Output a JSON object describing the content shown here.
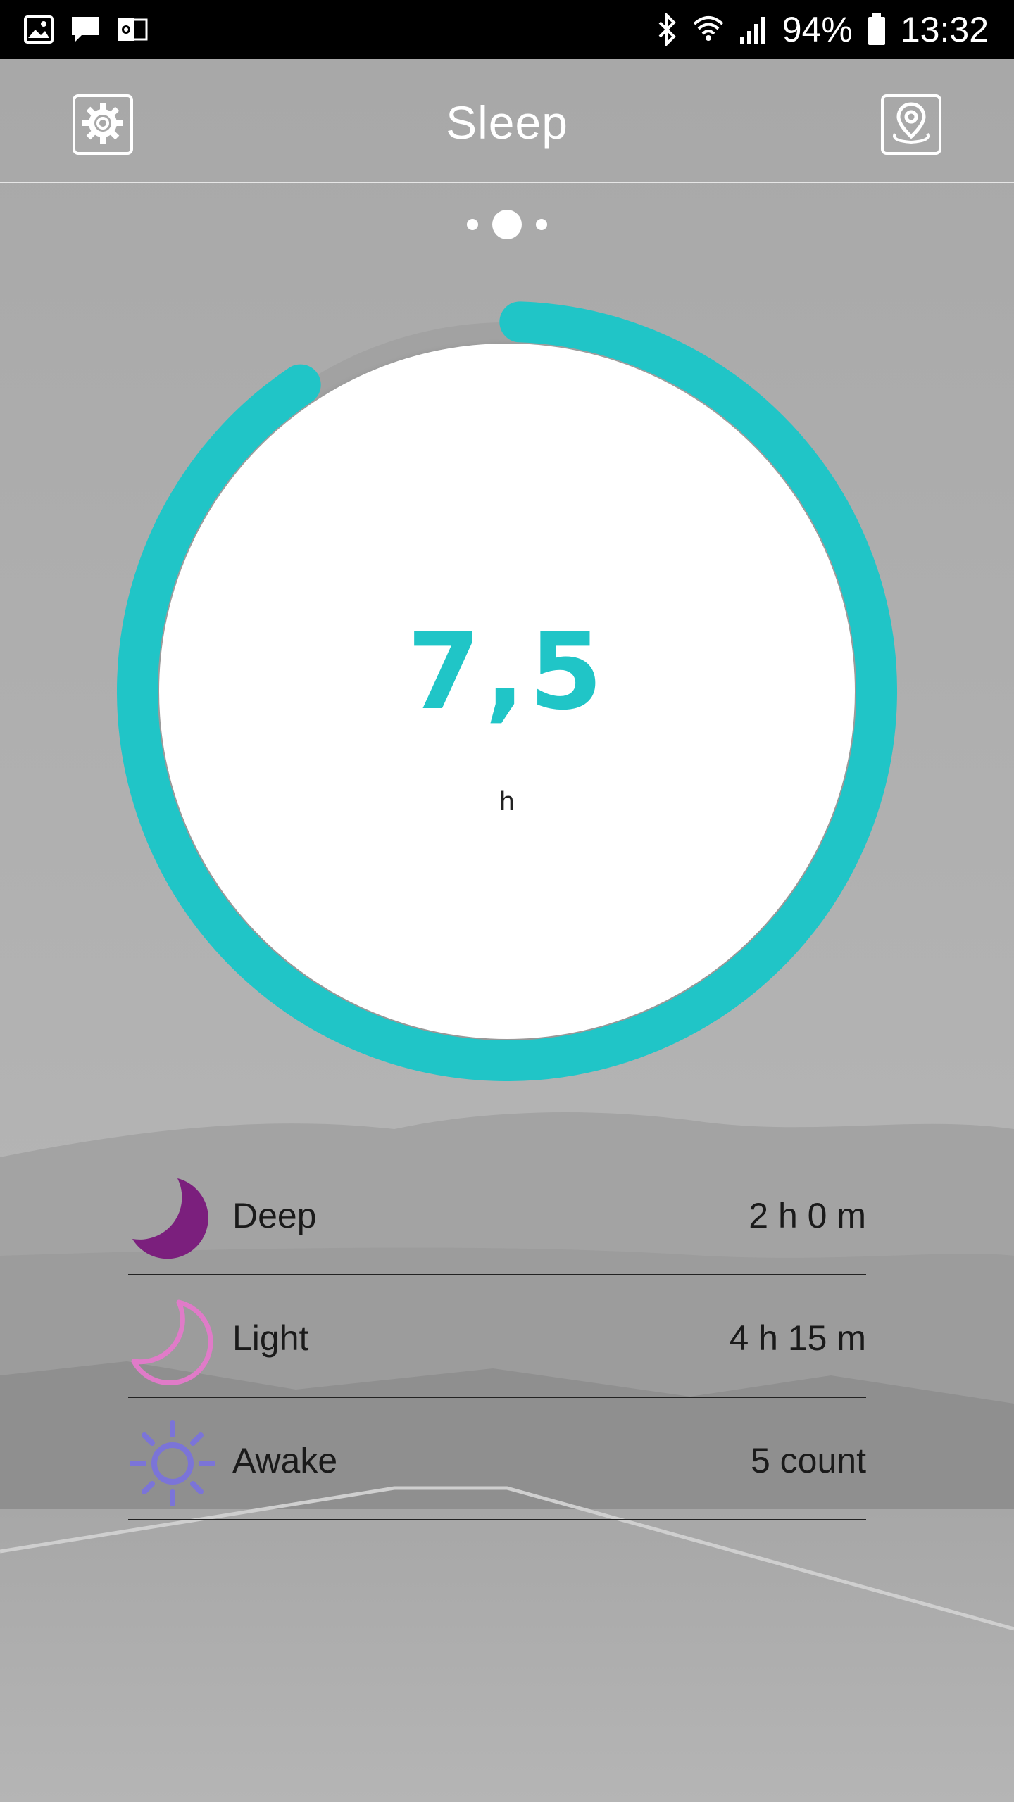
{
  "status_bar": {
    "battery": "94%",
    "time": "13:32",
    "left_icons": [
      "image-icon",
      "message-icon",
      "outlook-icon"
    ],
    "right_icons": [
      "bluetooth-icon",
      "wifi-icon",
      "signal-icon",
      "battery-icon"
    ]
  },
  "header": {
    "title": "Sleep",
    "left_button_icon": "settings-gear-icon",
    "right_button_icon": "location-pin-icon"
  },
  "pager": {
    "count": 3,
    "active": 1
  },
  "summary": {
    "value": "7,5",
    "unit": "h",
    "ring_progress": 0.9,
    "accent": "#20c5c7"
  },
  "stats": [
    {
      "icon": "deep-moon-icon",
      "label": "Deep",
      "value": "2 h 0 m",
      "color": "#7b1f7d"
    },
    {
      "icon": "light-moon-icon",
      "label": "Light",
      "value": "4 h 15 m",
      "color": "#e07bc8"
    },
    {
      "icon": "sun-icon",
      "label": "Awake",
      "value": "5 count",
      "color": "#7b74d8"
    }
  ]
}
